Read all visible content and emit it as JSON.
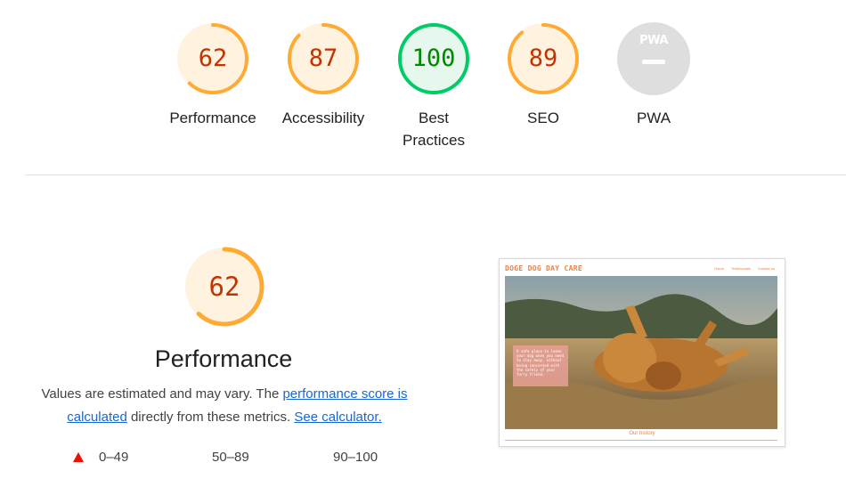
{
  "colors": {
    "average": "#fa3",
    "average_bg": "#fff3e0",
    "average_text": "#c33300",
    "pass": "#0c6",
    "pass_bg": "#e6f8ee",
    "pass_text": "#008800",
    "na": "#dedede",
    "fail": "#eb0f00",
    "link": "#1967d2"
  },
  "categories": [
    {
      "score": "62",
      "value": 0.62,
      "label": "Performance",
      "rating": "average"
    },
    {
      "score": "87",
      "value": 0.87,
      "label": "Accessibility",
      "rating": "average"
    },
    {
      "score": "100",
      "value": 1.0,
      "label": "Best Practices",
      "rating": "pass"
    },
    {
      "score": "89",
      "value": 0.89,
      "label": "SEO",
      "rating": "average"
    },
    {
      "score": "",
      "value": null,
      "label": "PWA",
      "rating": "na",
      "badge_text": "PWA"
    }
  ],
  "performance": {
    "score": "62",
    "value": 0.62,
    "title": "Performance",
    "desc_prefix": "Values are estimated and may vary. The ",
    "link_score": "performance score is calculated",
    "desc_middle": " directly from these metrics. ",
    "link_calc": "See calculator."
  },
  "legend": {
    "fail": "0–49",
    "average": "50–89",
    "pass": "90–100"
  },
  "screenshot": {
    "brand": "DOGE DOG DAY CARE",
    "nav": [
      "Home",
      "Testimonials",
      "Contact us"
    ],
    "card_text": "A safe place to leave your dog when you need to stay away, without being concerned with the safety of your furry friend.",
    "footer_link": "Our history"
  }
}
